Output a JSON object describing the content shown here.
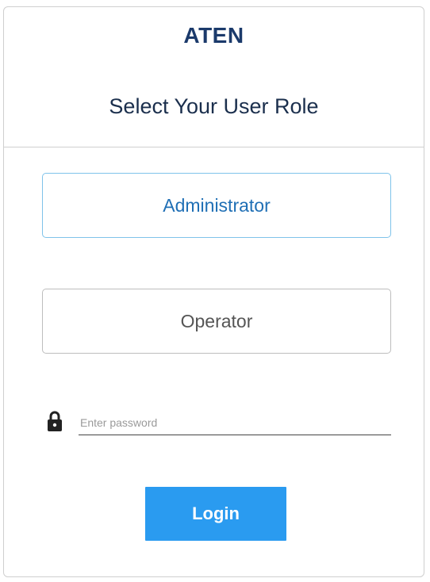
{
  "header": {
    "logo_text": "ATEN",
    "title": "Select Your User Role"
  },
  "roles": {
    "administrator": "Administrator",
    "operator": "Operator",
    "selected": "Administrator"
  },
  "password": {
    "placeholder": "Enter password",
    "value": "",
    "icon": "lock-icon"
  },
  "login": {
    "label": "Login"
  },
  "colors": {
    "brand": "#1b3a6b",
    "selected_border": "#7fc3ea",
    "selected_text": "#1f6fb5",
    "login_button": "#2a9bf0"
  }
}
